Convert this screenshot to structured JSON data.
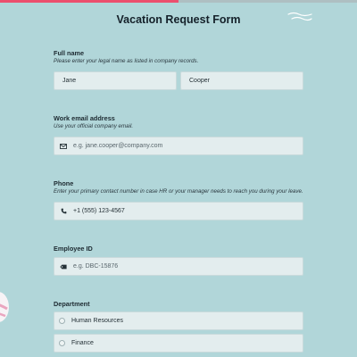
{
  "form": {
    "title": "Vacation Request Form"
  },
  "full_name": {
    "label": "Full name",
    "help": "Please enter your legal name as listed in company records.",
    "first_value": "Jane",
    "last_value": "Cooper"
  },
  "work_email": {
    "label": "Work email address",
    "help": "Use your official company email.",
    "placeholder": "e.g. jane.cooper@company.com",
    "icon": "envelope-icon"
  },
  "phone": {
    "label": "Phone",
    "help": "Enter your primary contact number in case HR or your manager needs to reach you during your leave.",
    "value": "+1 (555) 123-4567",
    "icon": "phone-icon"
  },
  "employee_id": {
    "label": "Employee ID",
    "placeholder": "e.g. DBC-15876",
    "icon": "id-tag-icon"
  },
  "department": {
    "label": "Department",
    "options": [
      "Human Resources",
      "Finance"
    ]
  },
  "progress": {
    "fraction": 0.5
  },
  "colors": {
    "background": "#b1d6d9",
    "accent": "#ec4f6e",
    "field_bg": "#e3edee"
  }
}
